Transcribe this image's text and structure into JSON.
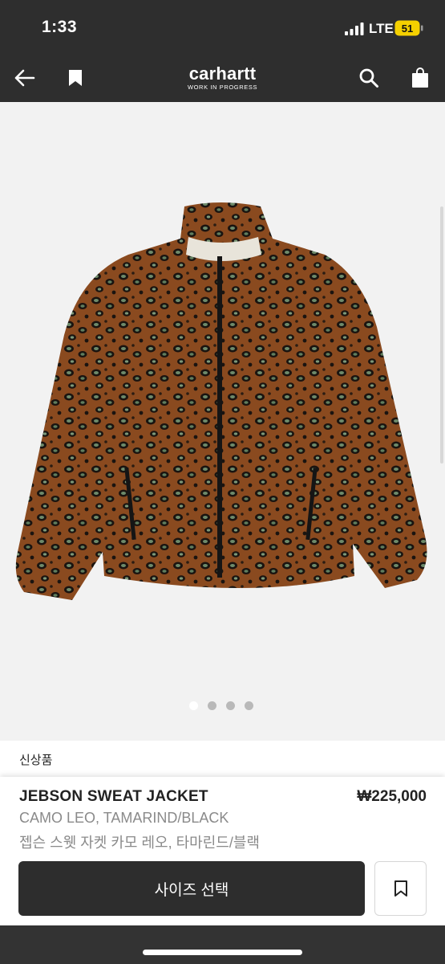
{
  "status_bar": {
    "time": "1:33",
    "network": "LTE",
    "battery": "51"
  },
  "nav": {
    "brand": "carhartt",
    "brand_sub": "WORK IN PROGRESS",
    "back_icon": "arrow-left-icon",
    "bookmark_icon": "bookmark-icon",
    "search_icon": "search-icon",
    "bag_icon": "shopping-bag-icon"
  },
  "gallery": {
    "image_count": 4,
    "active_index": 0
  },
  "product": {
    "badge": "신상품",
    "name": "JEBSON SWEAT JACKET",
    "price": "₩225,000",
    "color": "CAMO LEO, TAMARIND/BLACK",
    "korean_name": "젭슨 스웻 자켓 카모 레오, 타마린드/블랙"
  },
  "actions": {
    "select_size": "사이즈 선택"
  },
  "colors": {
    "header_bg": "#2e2e2e",
    "button_bg": "#2d2d2d",
    "gallery_bg": "#f2f2f2",
    "battery_accent": "#f5d000"
  }
}
